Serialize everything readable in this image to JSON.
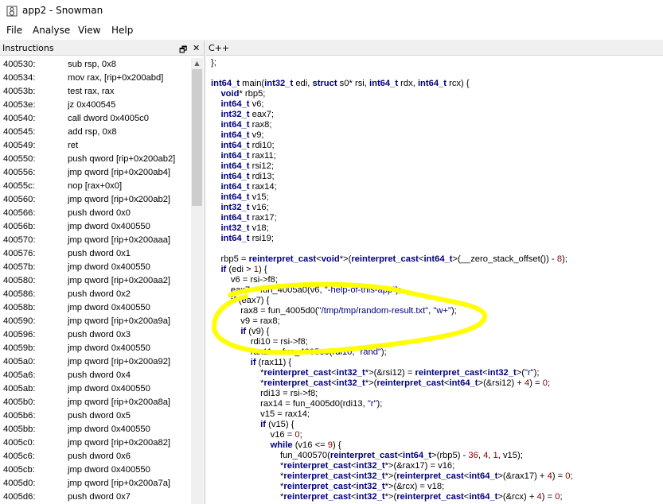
{
  "window": {
    "title": "app2 - Snowman"
  },
  "menu": [
    {
      "label": "File"
    },
    {
      "label": "Analyse"
    },
    {
      "label": "View"
    },
    {
      "label": "Help"
    }
  ],
  "instructions_pane": {
    "title": "Instructions",
    "restore_icon": "restore-icon",
    "close_icon": "close-icon",
    "rows": [
      {
        "addr": "400530:",
        "text": "sub rsp, 0x8"
      },
      {
        "addr": "400534:",
        "text": "mov rax, [rip+0x200abd]"
      },
      {
        "addr": "40053b:",
        "text": "test rax, rax"
      },
      {
        "addr": "40053e:",
        "text": "jz 0x400545"
      },
      {
        "addr": "400540:",
        "text": "call dword 0x4005c0"
      },
      {
        "addr": "400545:",
        "text": "add rsp, 0x8"
      },
      {
        "addr": "400549:",
        "text": "ret"
      },
      {
        "addr": "400550:",
        "text": "push qword [rip+0x200ab2]"
      },
      {
        "addr": "400556:",
        "text": "jmp qword [rip+0x200ab4]"
      },
      {
        "addr": "40055c:",
        "text": "nop [rax+0x0]"
      },
      {
        "addr": "400560:",
        "text": "jmp qword [rip+0x200ab2]"
      },
      {
        "addr": "400566:",
        "text": "push dword 0x0"
      },
      {
        "addr": "40056b:",
        "text": "jmp dword 0x400550"
      },
      {
        "addr": "400570:",
        "text": "jmp qword [rip+0x200aaa]"
      },
      {
        "addr": "400576:",
        "text": "push dword 0x1"
      },
      {
        "addr": "40057b:",
        "text": "jmp dword 0x400550"
      },
      {
        "addr": "400580:",
        "text": "jmp qword [rip+0x200aa2]"
      },
      {
        "addr": "400586:",
        "text": "push dword 0x2"
      },
      {
        "addr": "40058b:",
        "text": "jmp dword 0x400550"
      },
      {
        "addr": "400590:",
        "text": "jmp qword [rip+0x200a9a]"
      },
      {
        "addr": "400596:",
        "text": "push dword 0x3"
      },
      {
        "addr": "40059b:",
        "text": "jmp dword 0x400550"
      },
      {
        "addr": "4005a0:",
        "text": "jmp qword [rip+0x200a92]"
      },
      {
        "addr": "4005a6:",
        "text": "push dword 0x4"
      },
      {
        "addr": "4005ab:",
        "text": "jmp dword 0x400550"
      },
      {
        "addr": "4005b0:",
        "text": "jmp qword [rip+0x200a8a]"
      },
      {
        "addr": "4005b6:",
        "text": "push dword 0x5"
      },
      {
        "addr": "4005bb:",
        "text": "jmp dword 0x400550"
      },
      {
        "addr": "4005c0:",
        "text": "jmp qword [rip+0x200a82]"
      },
      {
        "addr": "4005c6:",
        "text": "push dword 0x6"
      },
      {
        "addr": "4005cb:",
        "text": "jmp dword 0x400550"
      },
      {
        "addr": "4005d0:",
        "text": "jmp qword [rip+0x200a7a]"
      },
      {
        "addr": "4005d6:",
        "text": "push dword 0x7"
      }
    ]
  },
  "code_pane": {
    "title": "C++",
    "highlight_color": "#ffff00",
    "lines": [
      [
        {
          "t": "};",
          "c": "plain"
        }
      ],
      [],
      [
        {
          "t": "int64_t",
          "c": "kw"
        },
        {
          "t": " main(",
          "c": "plain"
        },
        {
          "t": "int32_t",
          "c": "kw"
        },
        {
          "t": " edi, ",
          "c": "plain"
        },
        {
          "t": "struct",
          "c": "kw"
        },
        {
          "t": " s0* rsi, ",
          "c": "plain"
        },
        {
          "t": "int64_t",
          "c": "kw"
        },
        {
          "t": " rdx, ",
          "c": "plain"
        },
        {
          "t": "int64_t",
          "c": "kw"
        },
        {
          "t": " rcx) {",
          "c": "plain"
        }
      ],
      [
        {
          "t": "    ",
          "c": "plain"
        },
        {
          "t": "void",
          "c": "kw"
        },
        {
          "t": "* rbp5;",
          "c": "plain"
        }
      ],
      [
        {
          "t": "    ",
          "c": "plain"
        },
        {
          "t": "int64_t",
          "c": "kw"
        },
        {
          "t": " v6;",
          "c": "plain"
        }
      ],
      [
        {
          "t": "    ",
          "c": "plain"
        },
        {
          "t": "int32_t",
          "c": "kw"
        },
        {
          "t": " eax7;",
          "c": "plain"
        }
      ],
      [
        {
          "t": "    ",
          "c": "plain"
        },
        {
          "t": "int64_t",
          "c": "kw"
        },
        {
          "t": " rax8;",
          "c": "plain"
        }
      ],
      [
        {
          "t": "    ",
          "c": "plain"
        },
        {
          "t": "int64_t",
          "c": "kw"
        },
        {
          "t": " v9;",
          "c": "plain"
        }
      ],
      [
        {
          "t": "    ",
          "c": "plain"
        },
        {
          "t": "int64_t",
          "c": "kw"
        },
        {
          "t": " rdi10;",
          "c": "plain"
        }
      ],
      [
        {
          "t": "    ",
          "c": "plain"
        },
        {
          "t": "int64_t",
          "c": "kw"
        },
        {
          "t": " rax11;",
          "c": "plain"
        }
      ],
      [
        {
          "t": "    ",
          "c": "plain"
        },
        {
          "t": "int64_t",
          "c": "kw"
        },
        {
          "t": " rsi12;",
          "c": "plain"
        }
      ],
      [
        {
          "t": "    ",
          "c": "plain"
        },
        {
          "t": "int64_t",
          "c": "kw"
        },
        {
          "t": " rdi13;",
          "c": "plain"
        }
      ],
      [
        {
          "t": "    ",
          "c": "plain"
        },
        {
          "t": "int64_t",
          "c": "kw"
        },
        {
          "t": " rax14;",
          "c": "plain"
        }
      ],
      [
        {
          "t": "    ",
          "c": "plain"
        },
        {
          "t": "int64_t",
          "c": "kw"
        },
        {
          "t": " v15;",
          "c": "plain"
        }
      ],
      [
        {
          "t": "    ",
          "c": "plain"
        },
        {
          "t": "int32_t",
          "c": "kw"
        },
        {
          "t": " v16;",
          "c": "plain"
        }
      ],
      [
        {
          "t": "    ",
          "c": "plain"
        },
        {
          "t": "int64_t",
          "c": "kw"
        },
        {
          "t": " rax17;",
          "c": "plain"
        }
      ],
      [
        {
          "t": "    ",
          "c": "plain"
        },
        {
          "t": "int32_t",
          "c": "kw"
        },
        {
          "t": " v18;",
          "c": "plain"
        }
      ],
      [
        {
          "t": "    ",
          "c": "plain"
        },
        {
          "t": "int64_t",
          "c": "kw"
        },
        {
          "t": " rsi19;",
          "c": "plain"
        }
      ],
      [],
      [
        {
          "t": "    rbp5 = ",
          "c": "plain"
        },
        {
          "t": "reinterpret_cast",
          "c": "kw"
        },
        {
          "t": "<",
          "c": "plain"
        },
        {
          "t": "void",
          "c": "kw"
        },
        {
          "t": "*>(",
          "c": "plain"
        },
        {
          "t": "reinterpret_cast",
          "c": "kw"
        },
        {
          "t": "<",
          "c": "plain"
        },
        {
          "t": "int64_t",
          "c": "kw"
        },
        {
          "t": ">(__zero_stack_offset()) - ",
          "c": "plain"
        },
        {
          "t": "8",
          "c": "num"
        },
        {
          "t": ");",
          "c": "plain"
        }
      ],
      [
        {
          "t": "    ",
          "c": "plain"
        },
        {
          "t": "if",
          "c": "kw"
        },
        {
          "t": " (edi > ",
          "c": "plain"
        },
        {
          "t": "1",
          "c": "num"
        },
        {
          "t": ") {",
          "c": "plain"
        }
      ],
      [
        {
          "t": "        v6 = rsi->f8;",
          "c": "plain"
        }
      ],
      [
        {
          "t": "        eax7 = fun_4005a0(v6, ",
          "c": "plain"
        },
        {
          "t": "\"-help-of-this-app\"",
          "c": "str"
        },
        {
          "t": ");",
          "c": "plain"
        }
      ],
      [
        {
          "t": "        ",
          "c": "plain"
        },
        {
          "t": "if",
          "c": "kw"
        },
        {
          "t": " (eax7) {",
          "c": "plain"
        }
      ],
      [
        {
          "t": "            rax8 = fun_4005d0(",
          "c": "plain"
        },
        {
          "t": "\"/tmp/tmp/random-result.txt\"",
          "c": "str"
        },
        {
          "t": ", ",
          "c": "plain"
        },
        {
          "t": "\"w+\"",
          "c": "str"
        },
        {
          "t": ");",
          "c": "plain"
        }
      ],
      [
        {
          "t": "            v9 = rax8;",
          "c": "plain"
        }
      ],
      [
        {
          "t": "            ",
          "c": "plain"
        },
        {
          "t": "if",
          "c": "kw"
        },
        {
          "t": " (v9) {",
          "c": "plain"
        }
      ],
      [
        {
          "t": "                rdi10 = rsi->f8;",
          "c": "plain"
        }
      ],
      [
        {
          "t": "                rax11 = fun_4005e0(rdi10, ",
          "c": "plain"
        },
        {
          "t": "\"rand\"",
          "c": "str"
        },
        {
          "t": ");",
          "c": "plain"
        }
      ],
      [
        {
          "t": "                ",
          "c": "plain"
        },
        {
          "t": "if",
          "c": "kw"
        },
        {
          "t": " (rax11) {",
          "c": "plain"
        }
      ],
      [
        {
          "t": "                    *",
          "c": "plain"
        },
        {
          "t": "reinterpret_cast",
          "c": "kw"
        },
        {
          "t": "<",
          "c": "plain"
        },
        {
          "t": "int32_t",
          "c": "kw"
        },
        {
          "t": "*>(&rsi12) = ",
          "c": "plain"
        },
        {
          "t": "reinterpret_cast",
          "c": "kw"
        },
        {
          "t": "<",
          "c": "plain"
        },
        {
          "t": "int32_t",
          "c": "kw"
        },
        {
          "t": ">(",
          "c": "plain"
        },
        {
          "t": "\"r\"",
          "c": "str"
        },
        {
          "t": ");",
          "c": "plain"
        }
      ],
      [
        {
          "t": "                    *",
          "c": "plain"
        },
        {
          "t": "reinterpret_cast",
          "c": "kw"
        },
        {
          "t": "<",
          "c": "plain"
        },
        {
          "t": "int32_t",
          "c": "kw"
        },
        {
          "t": "*>(",
          "c": "plain"
        },
        {
          "t": "reinterpret_cast",
          "c": "kw"
        },
        {
          "t": "<",
          "c": "plain"
        },
        {
          "t": "int64_t",
          "c": "kw"
        },
        {
          "t": ">(&rsi12) + ",
          "c": "plain"
        },
        {
          "t": "4",
          "c": "num"
        },
        {
          "t": ") = ",
          "c": "plain"
        },
        {
          "t": "0",
          "c": "num"
        },
        {
          "t": ";",
          "c": "plain"
        }
      ],
      [
        {
          "t": "                    rdi13 = rsi->f8;",
          "c": "plain"
        }
      ],
      [
        {
          "t": "                    rax14 = fun_4005d0(rdi13, ",
          "c": "plain"
        },
        {
          "t": "\"r\"",
          "c": "str"
        },
        {
          "t": ");",
          "c": "plain"
        }
      ],
      [
        {
          "t": "                    v15 = rax14;",
          "c": "plain"
        }
      ],
      [
        {
          "t": "                    ",
          "c": "plain"
        },
        {
          "t": "if",
          "c": "kw"
        },
        {
          "t": " (v15) {",
          "c": "plain"
        }
      ],
      [
        {
          "t": "                        v16 = ",
          "c": "plain"
        },
        {
          "t": "0",
          "c": "num"
        },
        {
          "t": ";",
          "c": "plain"
        }
      ],
      [
        {
          "t": "                        ",
          "c": "plain"
        },
        {
          "t": "while",
          "c": "kw"
        },
        {
          "t": " (v16 <= ",
          "c": "plain"
        },
        {
          "t": "9",
          "c": "num"
        },
        {
          "t": ") {",
          "c": "plain"
        }
      ],
      [
        {
          "t": "                            fun_400570(",
          "c": "plain"
        },
        {
          "t": "reinterpret_cast",
          "c": "kw"
        },
        {
          "t": "<",
          "c": "plain"
        },
        {
          "t": "int64_t",
          "c": "kw"
        },
        {
          "t": ">(rbp5) - ",
          "c": "plain"
        },
        {
          "t": "36",
          "c": "num"
        },
        {
          "t": ", ",
          "c": "plain"
        },
        {
          "t": "4",
          "c": "num"
        },
        {
          "t": ", ",
          "c": "plain"
        },
        {
          "t": "1",
          "c": "num"
        },
        {
          "t": ", v15);",
          "c": "plain"
        }
      ],
      [
        {
          "t": "                            *",
          "c": "plain"
        },
        {
          "t": "reinterpret_cast",
          "c": "kw"
        },
        {
          "t": "<",
          "c": "plain"
        },
        {
          "t": "int32_t",
          "c": "kw"
        },
        {
          "t": "*>(&rax17) = v16;",
          "c": "plain"
        }
      ],
      [
        {
          "t": "                            *",
          "c": "plain"
        },
        {
          "t": "reinterpret_cast",
          "c": "kw"
        },
        {
          "t": "<",
          "c": "plain"
        },
        {
          "t": "int32_t",
          "c": "kw"
        },
        {
          "t": "*>(",
          "c": "plain"
        },
        {
          "t": "reinterpret_cast",
          "c": "kw"
        },
        {
          "t": "<",
          "c": "plain"
        },
        {
          "t": "int64_t",
          "c": "kw"
        },
        {
          "t": ">(&rax17) + ",
          "c": "plain"
        },
        {
          "t": "4",
          "c": "num"
        },
        {
          "t": ") = ",
          "c": "plain"
        },
        {
          "t": "0",
          "c": "num"
        },
        {
          "t": ";",
          "c": "plain"
        }
      ],
      [
        {
          "t": "                            *",
          "c": "plain"
        },
        {
          "t": "reinterpret_cast",
          "c": "kw"
        },
        {
          "t": "<",
          "c": "plain"
        },
        {
          "t": "int32_t",
          "c": "kw"
        },
        {
          "t": "*>(&rcx) = v18;",
          "c": "plain"
        }
      ],
      [
        {
          "t": "                            *",
          "c": "plain"
        },
        {
          "t": "reinterpret_cast",
          "c": "kw"
        },
        {
          "t": "<",
          "c": "plain"
        },
        {
          "t": "int32_t",
          "c": "kw"
        },
        {
          "t": "*>(",
          "c": "plain"
        },
        {
          "t": "reinterpret_cast",
          "c": "kw"
        },
        {
          "t": "<",
          "c": "plain"
        },
        {
          "t": "int64_t",
          "c": "kw"
        },
        {
          "t": ">(&rcx) + ",
          "c": "plain"
        },
        {
          "t": "4",
          "c": "num"
        },
        {
          "t": ") = ",
          "c": "plain"
        },
        {
          "t": "0",
          "c": "num"
        },
        {
          "t": ";",
          "c": "plain"
        }
      ]
    ]
  }
}
